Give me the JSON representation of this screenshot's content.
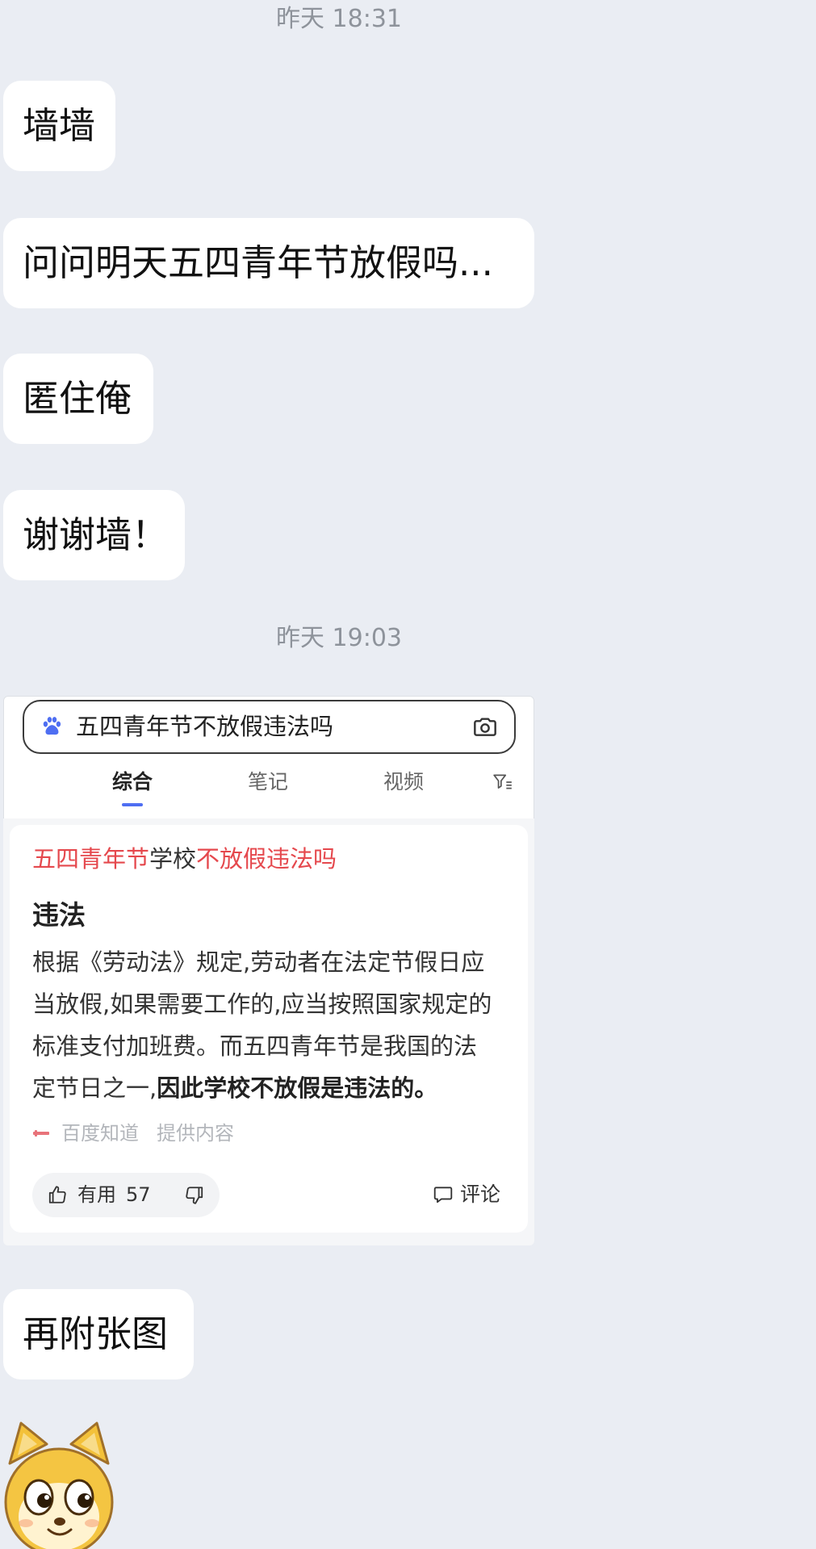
{
  "colors": {
    "background": "#eaedf3",
    "bubble": "#ffffff",
    "timestamp": "#8e939b",
    "highlight_red": "#e5484d",
    "accent_blue": "#4e6ef2"
  },
  "icons": {
    "search_logo": "baidu-paw-icon",
    "camera": "camera-icon",
    "filter": "filter-icon",
    "source_logo": "source-logo-icon",
    "like": "thumbs-up-icon",
    "dislike": "thumbs-down-icon",
    "comment": "comment-icon",
    "sticker": "dog-face-sticker"
  },
  "chat": {
    "timestamps": [
      "昨天 18:31",
      "昨天 19:03"
    ],
    "messages": [
      "墙墙",
      "问问明天五四青年节放假吗...",
      "匿住俺",
      "谢谢墙！",
      "再附张图"
    ]
  },
  "shared_image": {
    "search_query": "五四青年节不放假违法吗",
    "tabs": [
      "综合",
      "笔记",
      "视频"
    ],
    "active_tab_index": 0,
    "result": {
      "title_highlight_1": "五四青年节",
      "title_plain": "学校",
      "title_highlight_2": "不放假违法吗",
      "answer": "违法",
      "body_lines": [
        "根据《劳动法》规定,劳动者在法定节假日应",
        "当放假,如果需要工作的,应当按照国家规定的",
        "标准支付加班费。而五四青年节是我国的法",
        "定节日之一,"
      ],
      "body_emphasis": "因此学校不放假是违法的。",
      "source_name": "百度知道",
      "source_suffix": "提供内容",
      "useful_label": "有用",
      "useful_count": 57,
      "comment_label": "评论"
    }
  }
}
